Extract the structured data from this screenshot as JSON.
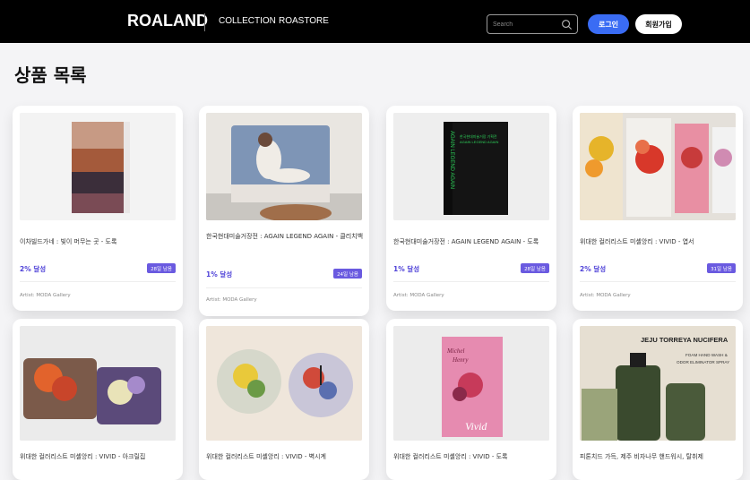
{
  "header": {
    "brand": "ROALAND",
    "nav": [
      "COLLECTION",
      "ROASTORE"
    ],
    "search_placeholder": "Search",
    "login_label": "로그인",
    "signup_label": "회원가입"
  },
  "page_title": "상품 목록",
  "products": [
    {
      "title": "이차빌드가네 : 빛이 머무는 곳 - 도록",
      "percent": "2% 달성",
      "days": "28일 남음",
      "artist": "Artist: MODA Gallery"
    },
    {
      "title": "한국현대미술거장전 : AGAIN LEGEND AGAIN - 클리치백",
      "percent": "1% 달성",
      "days": "24일 남음",
      "artist": "Artist: MODA Gallery"
    },
    {
      "title": "한국현대미술거장전 : AGAIN LEGEND AGAIN - 도록",
      "percent": "1% 달성",
      "days": "28일 남음",
      "artist": "Artist: MODA Gallery"
    },
    {
      "title": "위대한 컬러리스트 미셸앙리 : VIVID - 엽서",
      "percent": "2% 달성",
      "days": "31일 남음",
      "artist": "Artist: MODA Gallery"
    },
    {
      "title": "위대한 컬러리스트 미셸앙리 : VIVID - 아크릴집",
      "percent": "",
      "days": "",
      "artist": ""
    },
    {
      "title": "위대한 컬러리스트 미셸앙리 : VIVID - 벽시계",
      "percent": "",
      "days": "",
      "artist": ""
    },
    {
      "title": "위대한 컬러리스트 미셸앙리 : VIVID - 도록",
      "percent": "",
      "days": "",
      "artist": ""
    },
    {
      "title": "피톤치드 가득, 제주 비자나무 핸드워시, 탈취제",
      "percent": "",
      "days": "",
      "artist": ""
    }
  ],
  "book_cover_text": {
    "again_legend_spine": "AGAIN LEGEND AGAIN",
    "again_legend_title1": "한국현대미술거장 기획전",
    "again_legend_title2": "AGAIN LEGEND AGAIN",
    "vivid_name1": "Michel",
    "vivid_name2": "Henry",
    "vivid_title": "Vivid",
    "jeju_title": "JEJU TORREYA NUCIFERA",
    "jeju_sub1": "FOAM HAND WASH &",
    "jeju_sub2": "ODOR ELIMINATOR SPRAY"
  },
  "colors": {
    "header_bg": "#000000",
    "login_button": "#3a6cf4",
    "progress_text": "#4f42d8",
    "badge": "#6a5ae0"
  },
  "icons": [
    "search-icon"
  ]
}
